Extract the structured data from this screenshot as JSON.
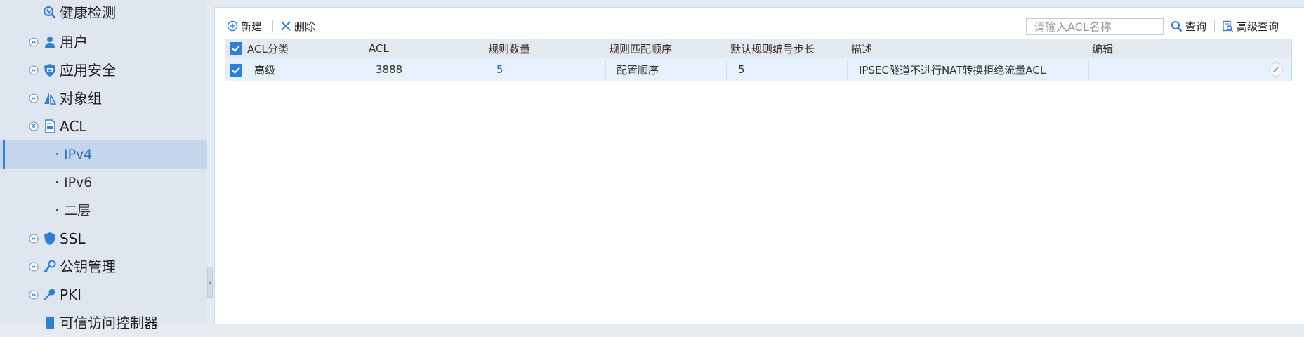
{
  "sidebar": {
    "items": [
      {
        "label": "健康检测"
      },
      {
        "label": "用户"
      },
      {
        "label": "应用安全"
      },
      {
        "label": "对象组"
      },
      {
        "label": "ACL"
      },
      {
        "label": "SSL"
      },
      {
        "label": "公钥管理"
      },
      {
        "label": "PKI"
      },
      {
        "label": "可信访问控制器"
      }
    ],
    "acl_children": [
      {
        "label": "IPv4",
        "active": true
      },
      {
        "label": "IPv6"
      },
      {
        "label": "二层"
      }
    ]
  },
  "toolbar": {
    "new_label": "新建",
    "delete_label": "删除",
    "search_placeholder": "请输入ACL名称",
    "query_label": "查询",
    "advanced_query_label": "高级查询"
  },
  "table": {
    "columns": [
      "ACL分类",
      "ACL",
      "规则数量",
      "规则匹配顺序",
      "默认规则编号步长",
      "描述",
      "编辑"
    ],
    "rows": [
      {
        "category": "高级",
        "acl": "3888",
        "rule_count": "5",
        "match_order": "配置顺序",
        "step": "5",
        "description": "IPSEC隧道不进行NAT转换拒绝流量ACL",
        "checked": true
      }
    ]
  },
  "colors": {
    "accent": "#2f7ed8",
    "sidebar_bg": "#dfe6f0",
    "active_item_bg": "#c3d6ec",
    "selected_row_bg": "#e6f1fb"
  }
}
